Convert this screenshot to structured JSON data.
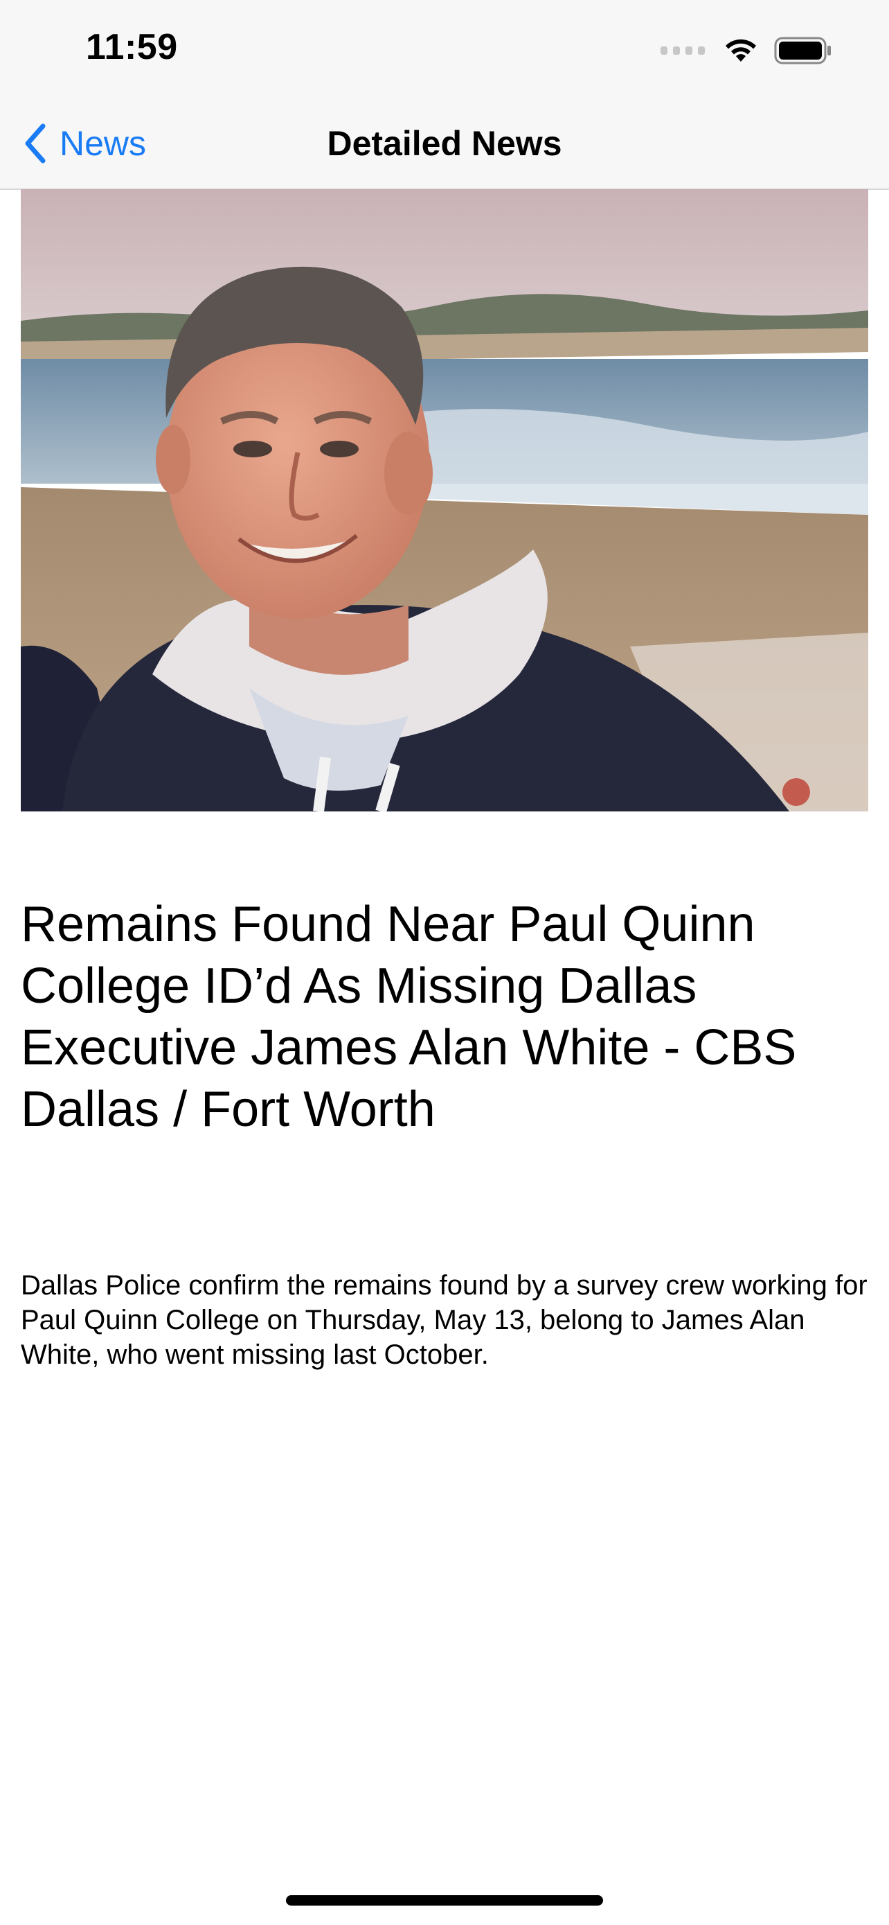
{
  "status_bar": {
    "time": "11:59",
    "icons": [
      "cellular-signal-icon",
      "wifi-icon",
      "battery-icon"
    ]
  },
  "nav": {
    "back_label": "News",
    "back_icon": "chevron-left-icon",
    "title": "Detailed News"
  },
  "article": {
    "image_description_icon": "photo-of-man-on-beach",
    "headline": "Remains Found Near Paul Quinn College ID’d As Missing Dallas Executive James Alan White - CBS Dallas / Fort Worth",
    "summary": "Dallas Police confirm the remains found by a survey crew working for Paul Quinn College on Thursday, May 13, belong to James Alan White, who went missing last October."
  },
  "colors": {
    "accent": "#1a7cf5",
    "nav_background": "#f7f7f7",
    "text": "#000000"
  }
}
